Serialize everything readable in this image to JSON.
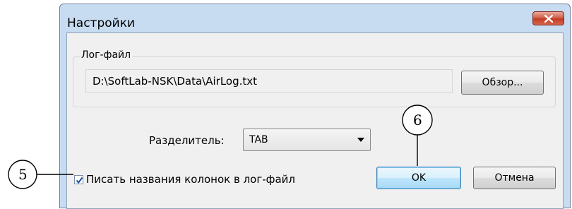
{
  "window": {
    "title": "Настройки",
    "close_icon": "close-icon"
  },
  "log_group": {
    "label": "Лог-файл",
    "path_value": "D:\\SoftLab-NSK\\Data\\AirLog.txt",
    "browse_label": "Обзор..."
  },
  "separator": {
    "label": "Разделитель:",
    "selected": "TAB"
  },
  "write_headers": {
    "label": "Писать названия колонок в лог-файл",
    "checked": true
  },
  "buttons": {
    "ok": "OK",
    "cancel": "Отмена"
  },
  "callouts": [
    "5",
    "6"
  ],
  "colors": {
    "window_frame": "#c8dcf1",
    "client_bg": "#f0f0f0",
    "close_button": "#c03a21",
    "default_button": "#a7d9f5"
  }
}
